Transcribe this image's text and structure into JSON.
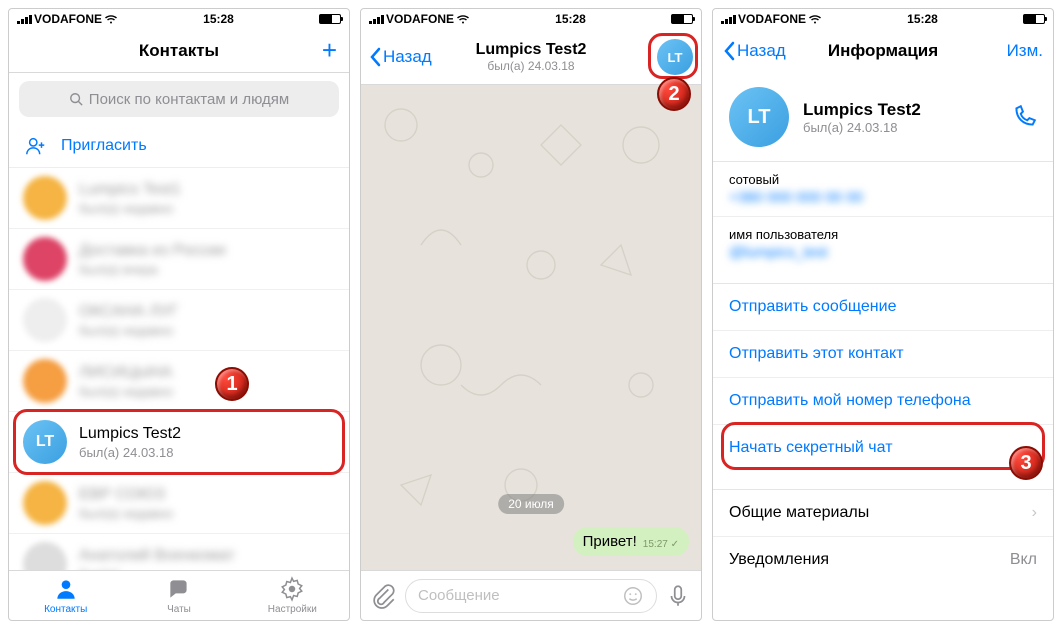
{
  "status": {
    "carrier": "VODAFONE",
    "time": "15:28"
  },
  "s1": {
    "title": "Контакты",
    "search_ph": "Поиск по контактам и людям",
    "invite": "Пригласить",
    "contact": {
      "name": "Lumpics Test2",
      "sub": "был(а) 24.03.18",
      "initials": "LT"
    },
    "tabs": {
      "contacts": "Контакты",
      "chats": "Чаты",
      "settings": "Настройки"
    }
  },
  "s2": {
    "back": "Назад",
    "title": "Lumpics Test2",
    "sub": "был(а) 24.03.18",
    "initials": "LT",
    "date": "20 июля",
    "msg": "Привет!",
    "msg_time": "15:27",
    "input_ph": "Сообщение"
  },
  "s3": {
    "back": "Назад",
    "title": "Информация",
    "edit": "Изм.",
    "name": "Lumpics Test2",
    "sub": "был(а) 24.03.18",
    "initials": "LT",
    "phone_label": "сотовый",
    "phone_val": "+380 000 000 00 00",
    "user_label": "имя пользователя",
    "user_val": "@lumpics_test",
    "act_msg": "Отправить сообщение",
    "act_contact": "Отправить этот контакт",
    "act_phone": "Отправить мой номер телефона",
    "act_secret": "Начать секретный чат",
    "shared": "Общие материалы",
    "notif": "Уведомления",
    "notif_val": "Вкл"
  },
  "badges": {
    "b1": "1",
    "b2": "2",
    "b3": "3"
  }
}
